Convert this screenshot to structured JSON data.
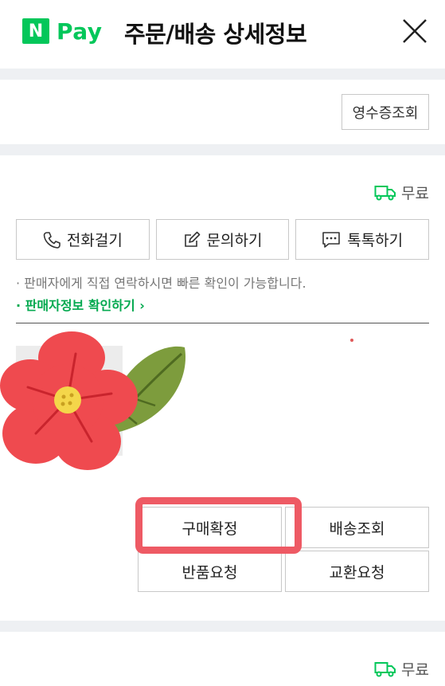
{
  "header": {
    "logo_n": "N",
    "logo_pay": "Pay",
    "title": "주문/배송 상세정보",
    "close_icon": "close-icon"
  },
  "receipt": {
    "label": "영수증조회"
  },
  "section1": {
    "shipping_fee": "무료",
    "actions": [
      {
        "icon": "phone-icon",
        "label": "전화걸기"
      },
      {
        "icon": "edit-icon",
        "label": "문의하기"
      },
      {
        "icon": "chat-icon",
        "label": "톡톡하기"
      }
    ],
    "notice": "판매자에게 직접 연락하시면 빠른 확인이 가능합니다.",
    "seller_link": "판매자정보 확인하기",
    "order_buttons": {
      "confirm": "구매확정",
      "track": "배송조회",
      "return": "반품요청",
      "exchange": "교환요청"
    }
  },
  "section2": {
    "shipping_fee": "무료"
  },
  "colors": {
    "accent": "#03c75a",
    "highlight": "#ee5a64",
    "divider": "#eef0f3"
  }
}
